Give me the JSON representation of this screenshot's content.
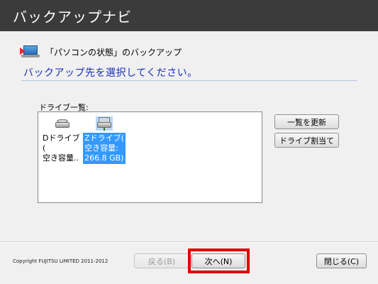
{
  "window": {
    "title": "バックアップナビ"
  },
  "header": {
    "section_title": "「パソコンの状態」のバックアップ",
    "instruction": "バックアップ先を選択してください。"
  },
  "drive_list": {
    "label": "ドライブ一覧:",
    "items": [
      {
        "line1": "Dドライブ(",
        "line2": "空き容量..",
        "line3": "",
        "selected": false,
        "icon": "hard-drive-icon"
      },
      {
        "line1": "Zドライブ(",
        "line2": "空き容量:",
        "line3": "266.8 GB)",
        "selected": true,
        "icon": "network-drive-icon"
      }
    ]
  },
  "side_buttons": {
    "refresh_label": "一覧を更新",
    "assign_label": "ドライブ割当て"
  },
  "footer": {
    "copyright": "Copyright FUJITSU LIMITED 2011-2012",
    "back_label": "戻る(B)",
    "next_label": "次へ(N)",
    "close_label": "閉じる(C)"
  },
  "colors": {
    "titlebar": "#3b3b3b",
    "instruction_text": "#1a2fb8",
    "selection": "#3399ff",
    "highlight_box": "#e00000"
  }
}
